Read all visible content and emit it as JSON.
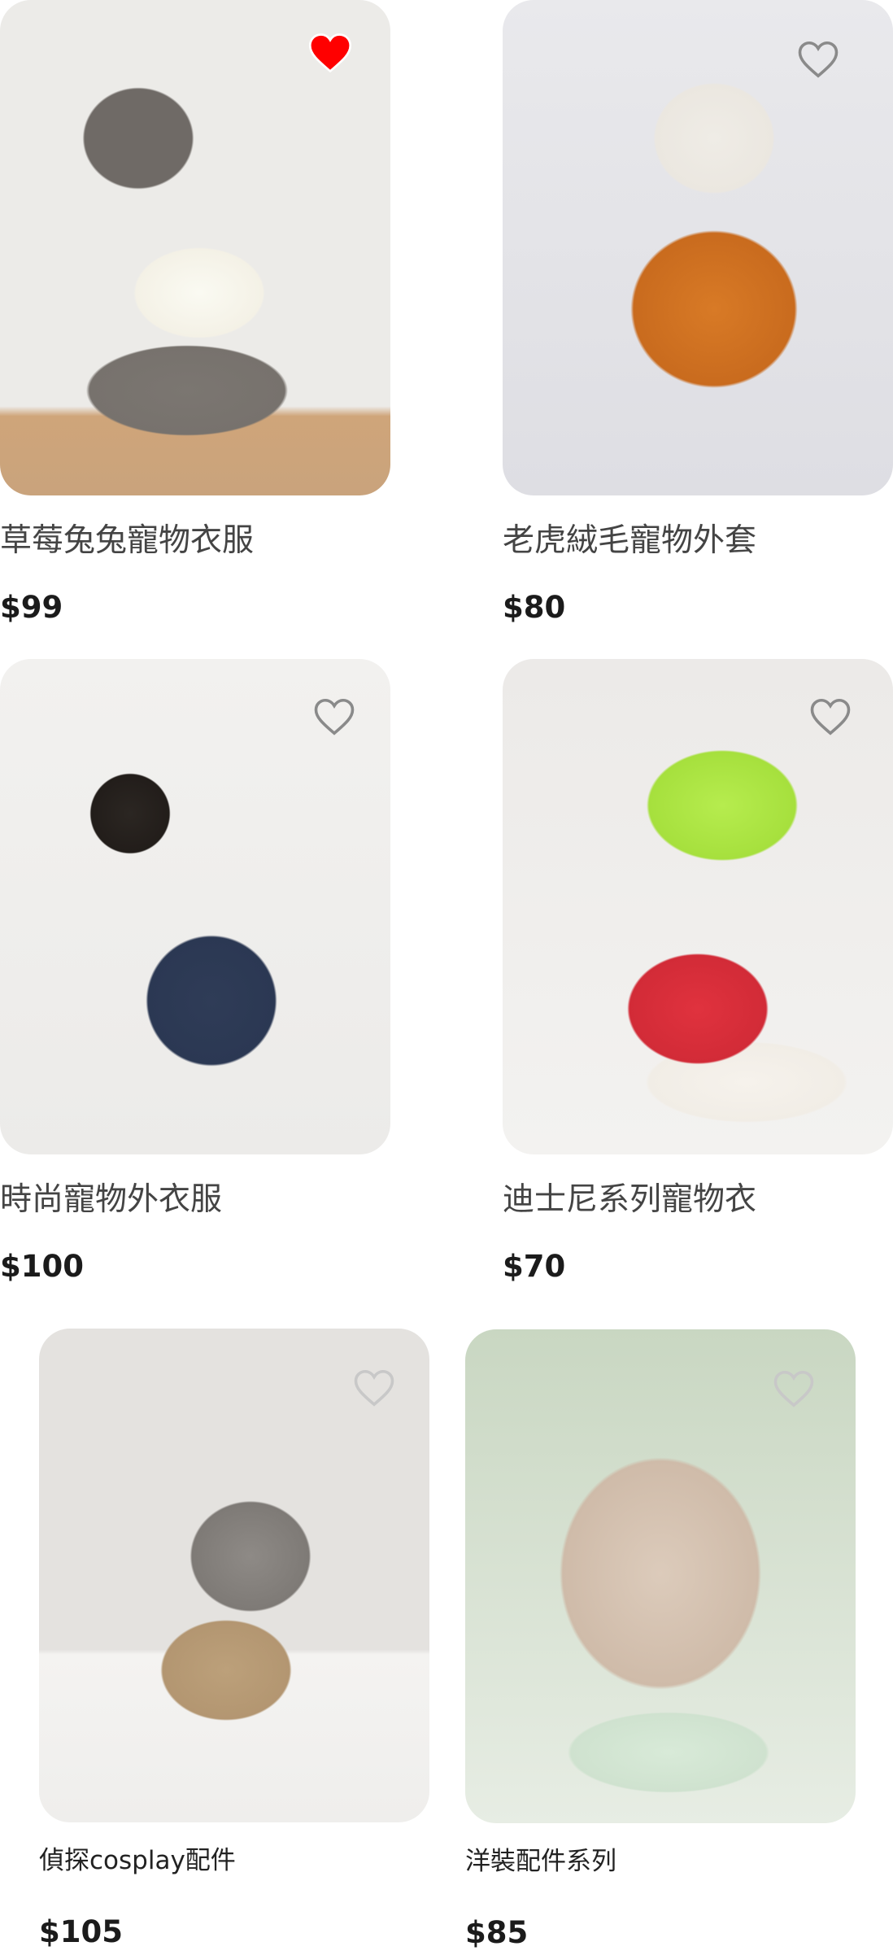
{
  "products": [
    {
      "name": "草莓兔兔寵物衣服",
      "price": "$99",
      "favorited": true,
      "image": "poodle-strawberry-shirt"
    },
    {
      "name": "老虎絨毛寵物外套",
      "price": "$80",
      "favorited": false,
      "image": "bulldog-tiger-hoodie"
    },
    {
      "name": "時尚寵物外衣服",
      "price": "$100",
      "favorited": false,
      "image": "shiba-navy-jacket"
    },
    {
      "name": "迪士尼系列寵物衣",
      "price": "$70",
      "favorited": false,
      "image": "chihuahuas-disney-hoodies"
    },
    {
      "name": "偵探cosplay配件",
      "price": "$105",
      "favorited": false,
      "image": "cat-detective-costume"
    },
    {
      "name": "洋裝配件系列",
      "price": "$85",
      "favorited": false,
      "image": "cat-lace-collar"
    }
  ],
  "icons": {
    "favorite": "heart-icon"
  },
  "colors": {
    "favorite_active": "#ff0000",
    "favorite_inactive": "#8a8a8a"
  }
}
